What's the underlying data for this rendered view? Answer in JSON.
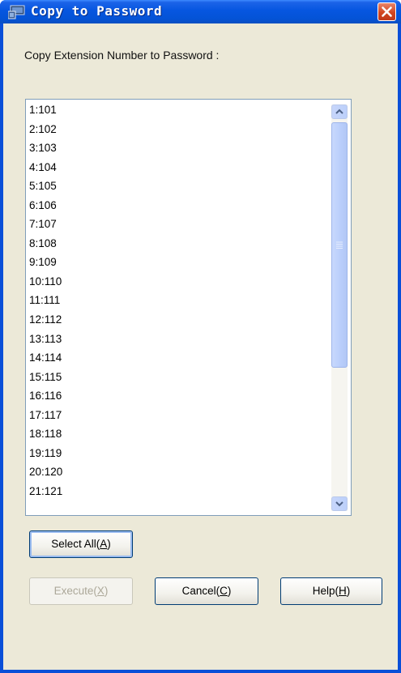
{
  "window": {
    "title": "Copy to Password"
  },
  "dialog": {
    "heading": "Copy Extension Number to Password :"
  },
  "list": {
    "items": [
      "1:101",
      "2:102",
      "3:103",
      "4:104",
      "5:105",
      "6:106",
      "7:107",
      "8:108",
      "9:109",
      "10:110",
      "11:111",
      "12:112",
      "13:113",
      "14:114",
      "15:115",
      "16:116",
      "17:117",
      "18:118",
      "19:119",
      "20:120",
      "21:121"
    ]
  },
  "buttons": {
    "select_all": {
      "label": "Select All(",
      "mnemonic": "A",
      "suffix": ")"
    },
    "execute": {
      "label": "Execute(",
      "mnemonic": "X",
      "suffix": ")",
      "enabled": false
    },
    "cancel": {
      "label": "Cancel(",
      "mnemonic": "C",
      "suffix": ")"
    },
    "help": {
      "label": "Help(",
      "mnemonic": "H",
      "suffix": ")"
    }
  },
  "icons": {
    "title_icon": "application-window-icon",
    "close": "close-icon",
    "scroll_up": "chevron-up-icon",
    "scroll_down": "chevron-down-icon",
    "thumb_grip": "grip-icon"
  },
  "colors": {
    "titlebar": "#0656e0",
    "dialog_bg": "#ece9d8",
    "close_button": "#d2461f",
    "scrollbar": "#bcd0fa"
  }
}
